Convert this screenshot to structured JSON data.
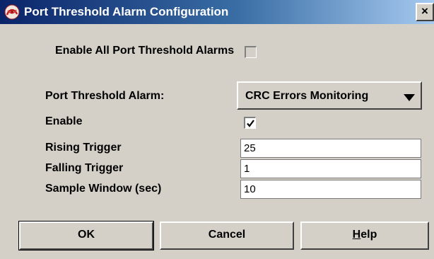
{
  "window": {
    "title": "Port Threshold Alarm Configuration",
    "close_glyph": "×"
  },
  "enable_all": {
    "label": "Enable All Port Threshold Alarms",
    "checked": false
  },
  "alarm": {
    "label": "Port Threshold Alarm:",
    "selected": "CRC Errors Monitoring"
  },
  "enable": {
    "label": "Enable",
    "checked": true
  },
  "rising": {
    "label": "Rising Trigger",
    "value": "25"
  },
  "falling": {
    "label": "Falling Trigger",
    "value": "1"
  },
  "sample": {
    "label": "Sample Window (sec)",
    "value": "10"
  },
  "buttons": {
    "ok": "OK",
    "cancel": "Cancel",
    "help_mnemonic": "H",
    "help_rest": "elp"
  },
  "colors": {
    "titlebar_start": "#0a246a",
    "titlebar_end": "#a6caf0",
    "dialog_bg": "#d4d0c8"
  },
  "icons": {
    "app": "app-logo-icon",
    "close": "close-icon",
    "dropdown": "triangle-down-icon",
    "check": "checkmark-icon"
  }
}
